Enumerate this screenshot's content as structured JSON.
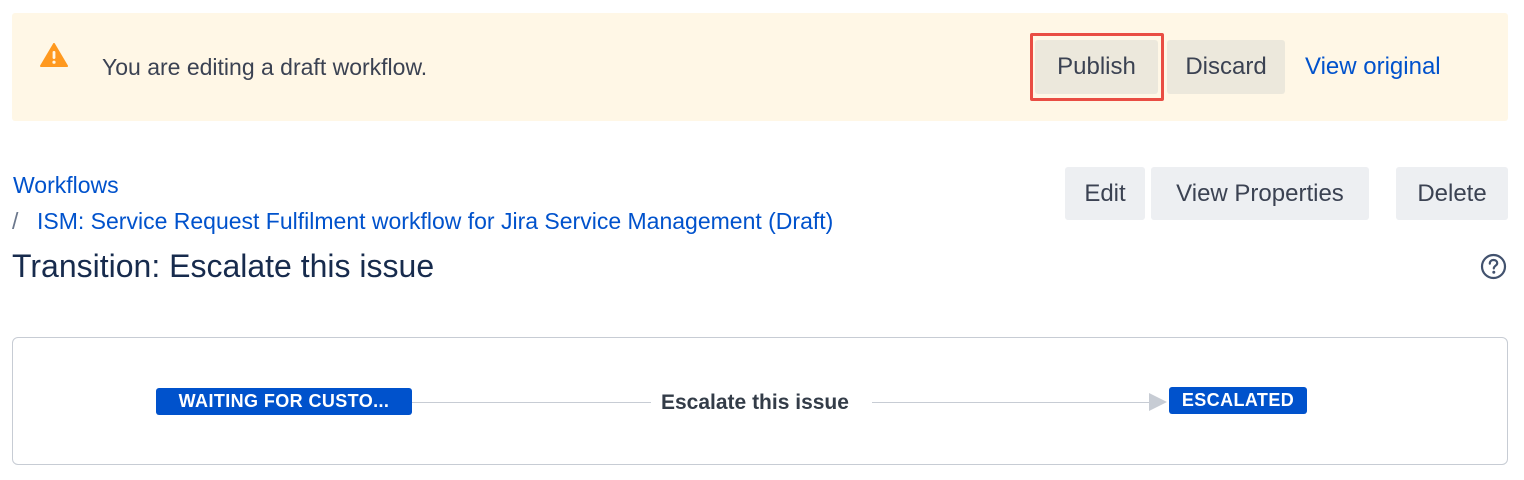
{
  "banner": {
    "icon": "warning-icon",
    "message": "You are editing a draft workflow.",
    "publish_label": "Publish",
    "discard_label": "Discard",
    "view_original_label": "View original",
    "colors": {
      "background": "#fff7e6",
      "warning": "#ff991f",
      "highlight": "#e94d43"
    }
  },
  "breadcrumb": {
    "root": "Workflows",
    "separator": "/",
    "current": "ISM: Service Request Fulfilment workflow for Jira Service Management (Draft)"
  },
  "page": {
    "title": "Transition: Escalate this issue",
    "help_icon": "help-circle-icon"
  },
  "actions": {
    "edit_label": "Edit",
    "view_properties_label": "View Properties",
    "delete_label": "Delete"
  },
  "transition": {
    "from_status": "WAITING FOR CUSTO...",
    "name": "Escalate this issue",
    "to_status": "ESCALATED",
    "status_color": "#0052cc"
  }
}
